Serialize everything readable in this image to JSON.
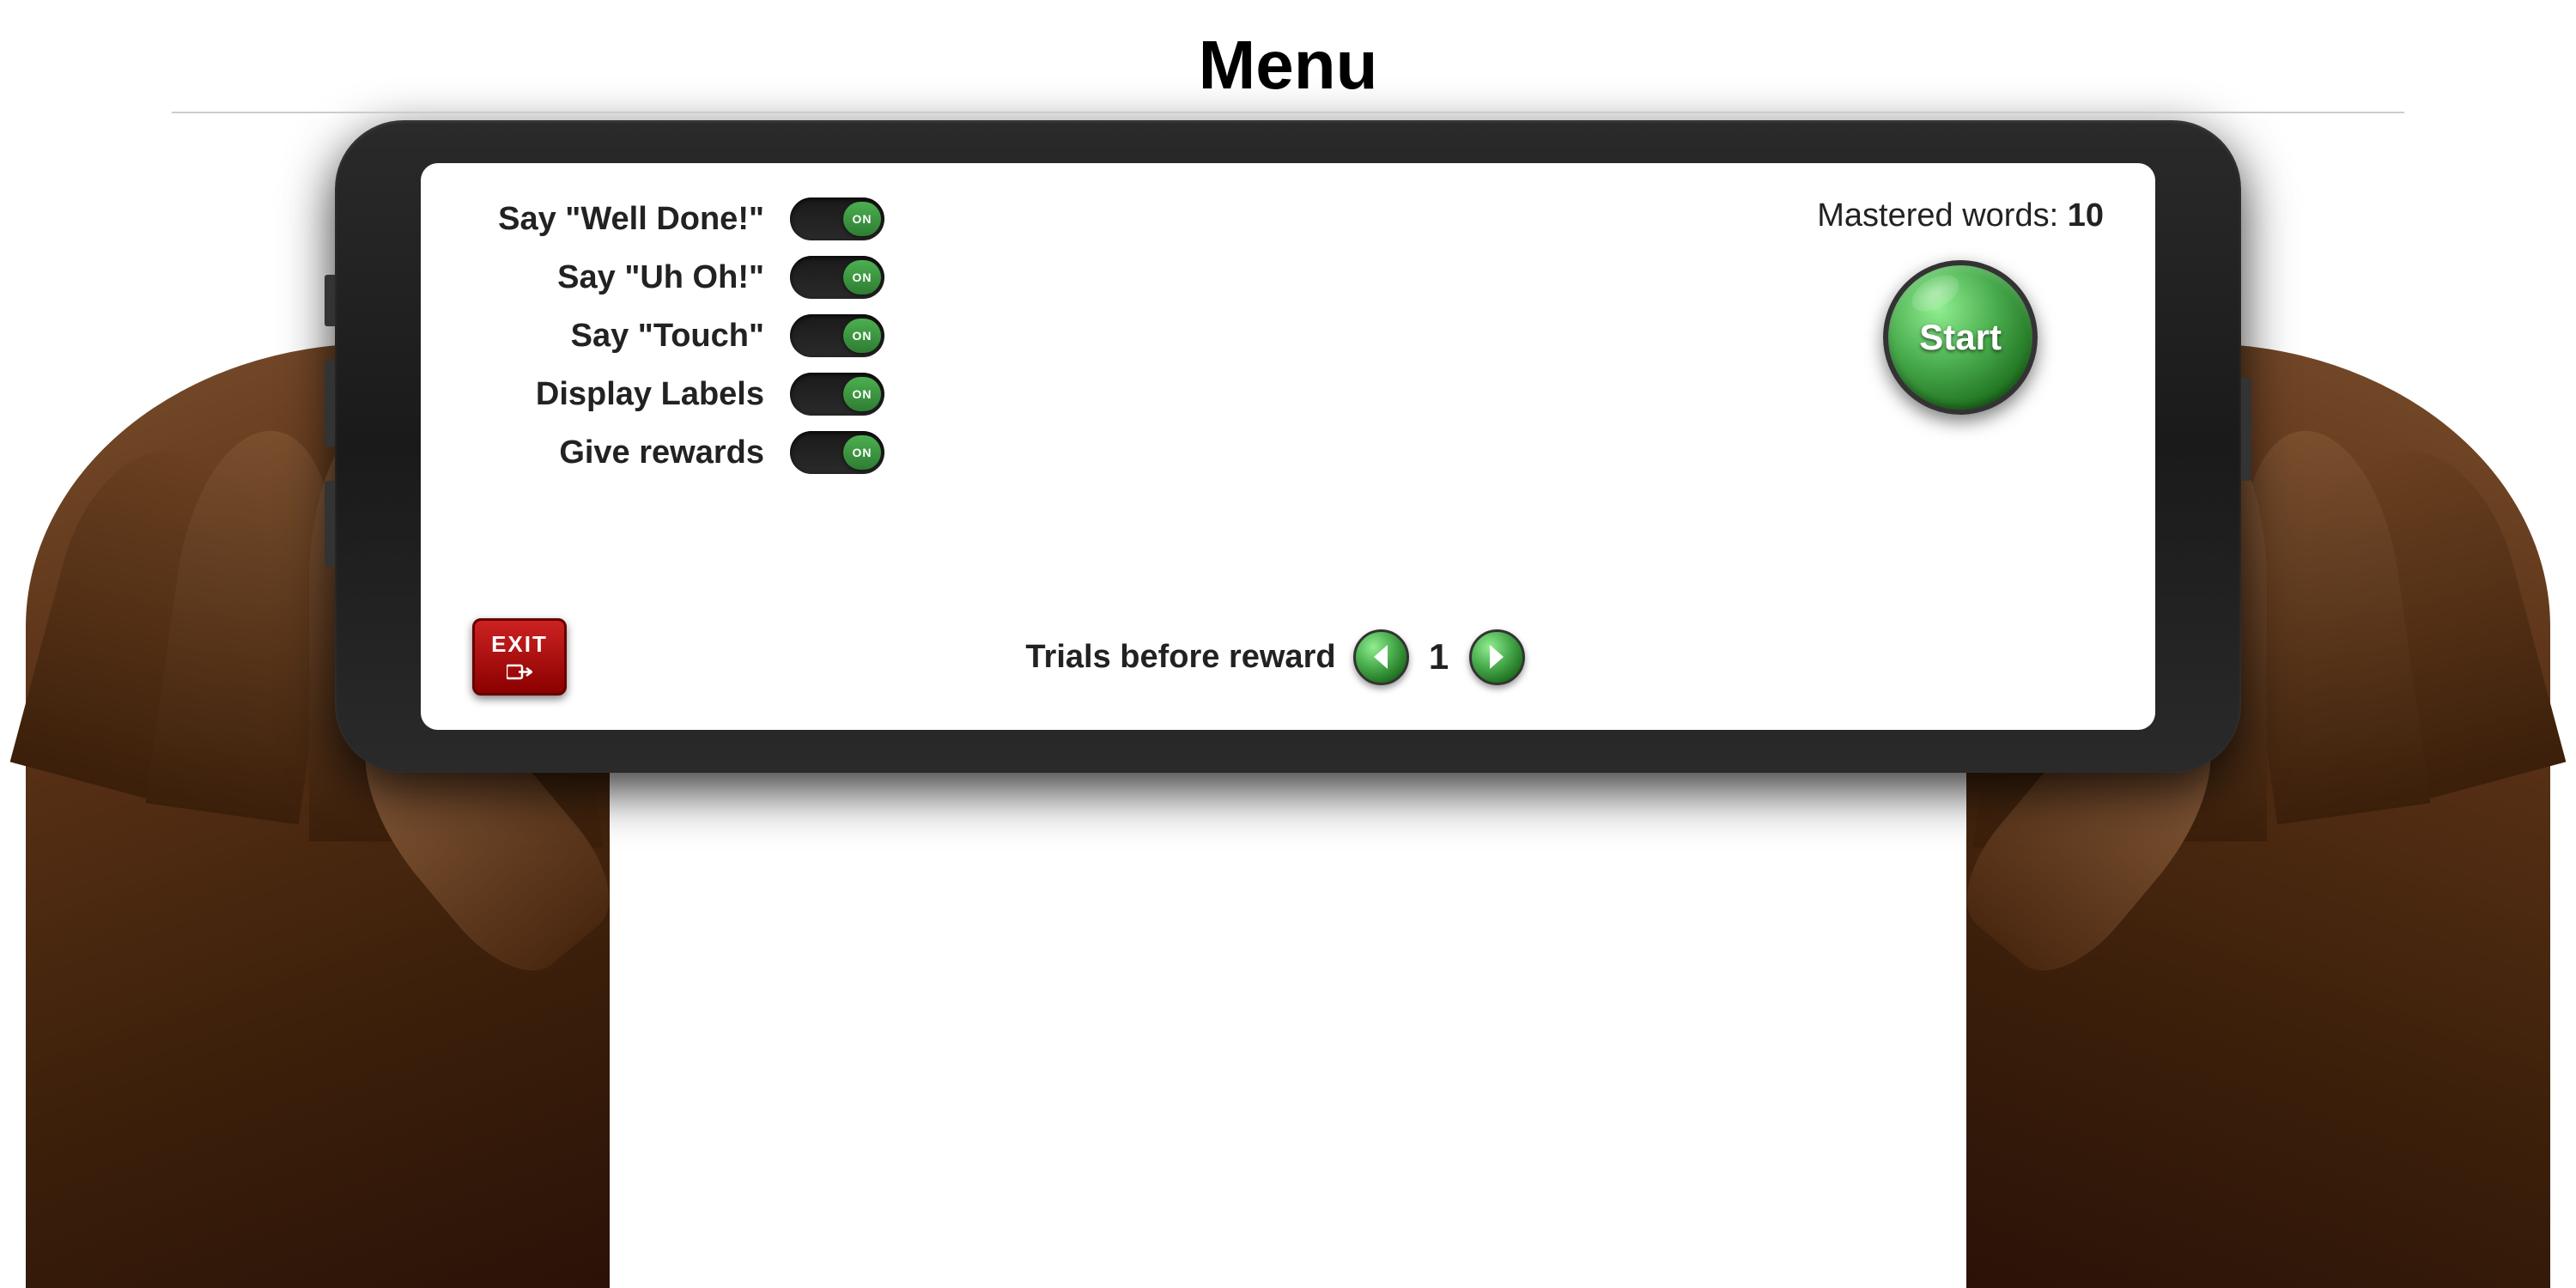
{
  "page": {
    "title": "Menu"
  },
  "screen": {
    "mastered_label": "Mastered words: ",
    "mastered_count": "10",
    "settings": [
      {
        "id": "say-well-done",
        "label": "Say \"Well Done!\"",
        "state": "ON"
      },
      {
        "id": "say-uh-oh",
        "label": "Say \"Uh Oh!\"",
        "state": "ON"
      },
      {
        "id": "say-touch",
        "label": "Say \"Touch\"",
        "state": "ON"
      },
      {
        "id": "display-labels",
        "label": "Display Labels",
        "state": "ON"
      },
      {
        "id": "give-rewards",
        "label": "Give rewards",
        "state": "ON"
      }
    ],
    "start_button_label": "Start",
    "trials_label": "Trials before reward",
    "trials_count": "1",
    "exit_label": "EXIT"
  }
}
